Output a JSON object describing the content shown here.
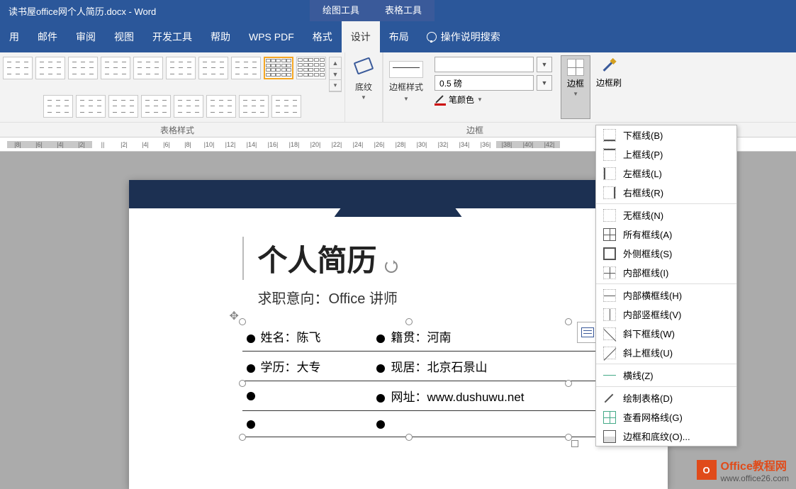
{
  "titlebar": {
    "doc_title": "读书屋office网个人简历.docx - Word",
    "context_draw": "绘图工具",
    "context_table": "表格工具"
  },
  "tabs": {
    "t1": "用",
    "t2": "邮件",
    "t3": "审阅",
    "t4": "视图",
    "t5": "开发工具",
    "t6": "帮助",
    "t7": "WPS PDF",
    "t8": "格式",
    "t9": "设计",
    "t10": "布局",
    "tell": "操作说明搜索"
  },
  "ribbon": {
    "table_styles_label": "表格样式",
    "shading_label": "底纹",
    "border_style_label": "边框样式",
    "weight": "0.5 磅",
    "pen_color": "笔颜色",
    "border_btn": "边框",
    "border_painter": "边框刷",
    "borders_group": "边框"
  },
  "dropdown": {
    "bottom": "下框线(B)",
    "top": "上框线(P)",
    "left": "左框线(L)",
    "right": "右框线(R)",
    "none": "无框线(N)",
    "all": "所有框线(A)",
    "outside": "外侧框线(S)",
    "inside": "内部框线(I)",
    "insideh": "内部横框线(H)",
    "insidev": "内部竖框线(V)",
    "diagdown": "斜下框线(W)",
    "diagup": "斜上框线(U)",
    "hline": "横线(Z)",
    "draw": "绘制表格(D)",
    "viewgrid": "查看网格线(G)",
    "more": "边框和底纹(O)..."
  },
  "ruler": [
    "8",
    "6",
    "4",
    "2",
    "",
    "2",
    "4",
    "6",
    "8",
    "10",
    "12",
    "14",
    "16",
    "18",
    "20",
    "22",
    "24",
    "26",
    "28",
    "30",
    "32",
    "34",
    "36",
    "38",
    "40",
    "42"
  ],
  "resume": {
    "title": "个人简历",
    "subtitle": "求职意向：Office 讲师",
    "rows": [
      {
        "l": "姓名：陈飞",
        "r": "籍贯：河南"
      },
      {
        "l": "学历：大专",
        "r": "现居：北京石景山"
      },
      {
        "l": "",
        "r": "网址：www.dushuwu.net"
      },
      {
        "l": "",
        "r": ""
      }
    ]
  },
  "watermark": {
    "icon": "O",
    "line1": "Office教程网",
    "line2": "www.office26.com"
  }
}
